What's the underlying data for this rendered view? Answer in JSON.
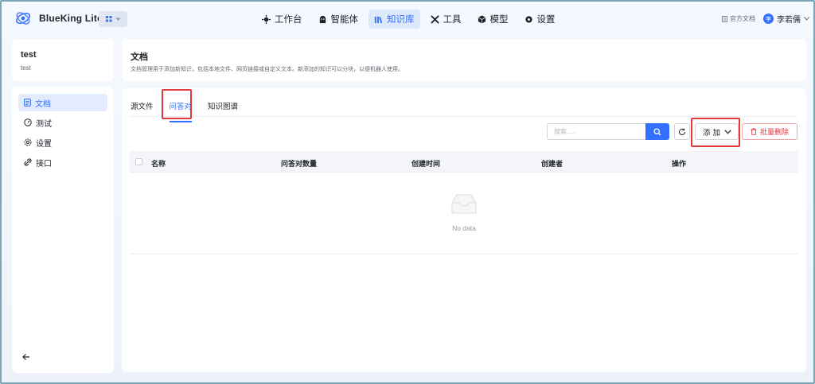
{
  "app": {
    "brand": "BlueKing Lite"
  },
  "nav": {
    "items": [
      {
        "label": "工作台",
        "icon": "workbench-icon",
        "active": false
      },
      {
        "label": "智能体",
        "icon": "agent-icon",
        "active": false
      },
      {
        "label": "知识库",
        "icon": "knowledge-base-icon",
        "active": true
      },
      {
        "label": "工具",
        "icon": "tools-icon",
        "active": false
      },
      {
        "label": "模型",
        "icon": "model-icon",
        "active": false
      },
      {
        "label": "设置",
        "icon": "settings-icon",
        "active": false
      }
    ],
    "doc_link": "官方文档",
    "user_name": "李若儒",
    "user_initial": "李"
  },
  "knowledge": {
    "title": "test",
    "subtitle": "test"
  },
  "sidebar": {
    "items": [
      {
        "label": "文档",
        "icon": "document-icon",
        "active": true
      },
      {
        "label": "测试",
        "icon": "test-icon",
        "active": false
      },
      {
        "label": "设置",
        "icon": "gear-icon",
        "active": false
      },
      {
        "label": "接口",
        "icon": "api-icon",
        "active": false
      }
    ]
  },
  "header": {
    "title": "文档",
    "description": "文档管理用于添加新知识，包括本地文件、网页链接或自定义文本。新添加的知识可以分块，以便机器人使用。"
  },
  "tabs": [
    {
      "label": "源文件",
      "active": false
    },
    {
      "label": "问答对",
      "active": true
    },
    {
      "label": "知识图谱",
      "active": false
    }
  ],
  "toolbar": {
    "search_placeholder": "搜索.....",
    "add_label": "添加",
    "batch_delete_label": "批量删除"
  },
  "table": {
    "columns": [
      "名称",
      "问答对数量",
      "创建时间",
      "创建者",
      "操作"
    ],
    "rows": [],
    "empty_text": "No data"
  },
  "colors": {
    "accent": "#3370ff",
    "danger": "#e0393e",
    "highlight": "#e0393e"
  }
}
